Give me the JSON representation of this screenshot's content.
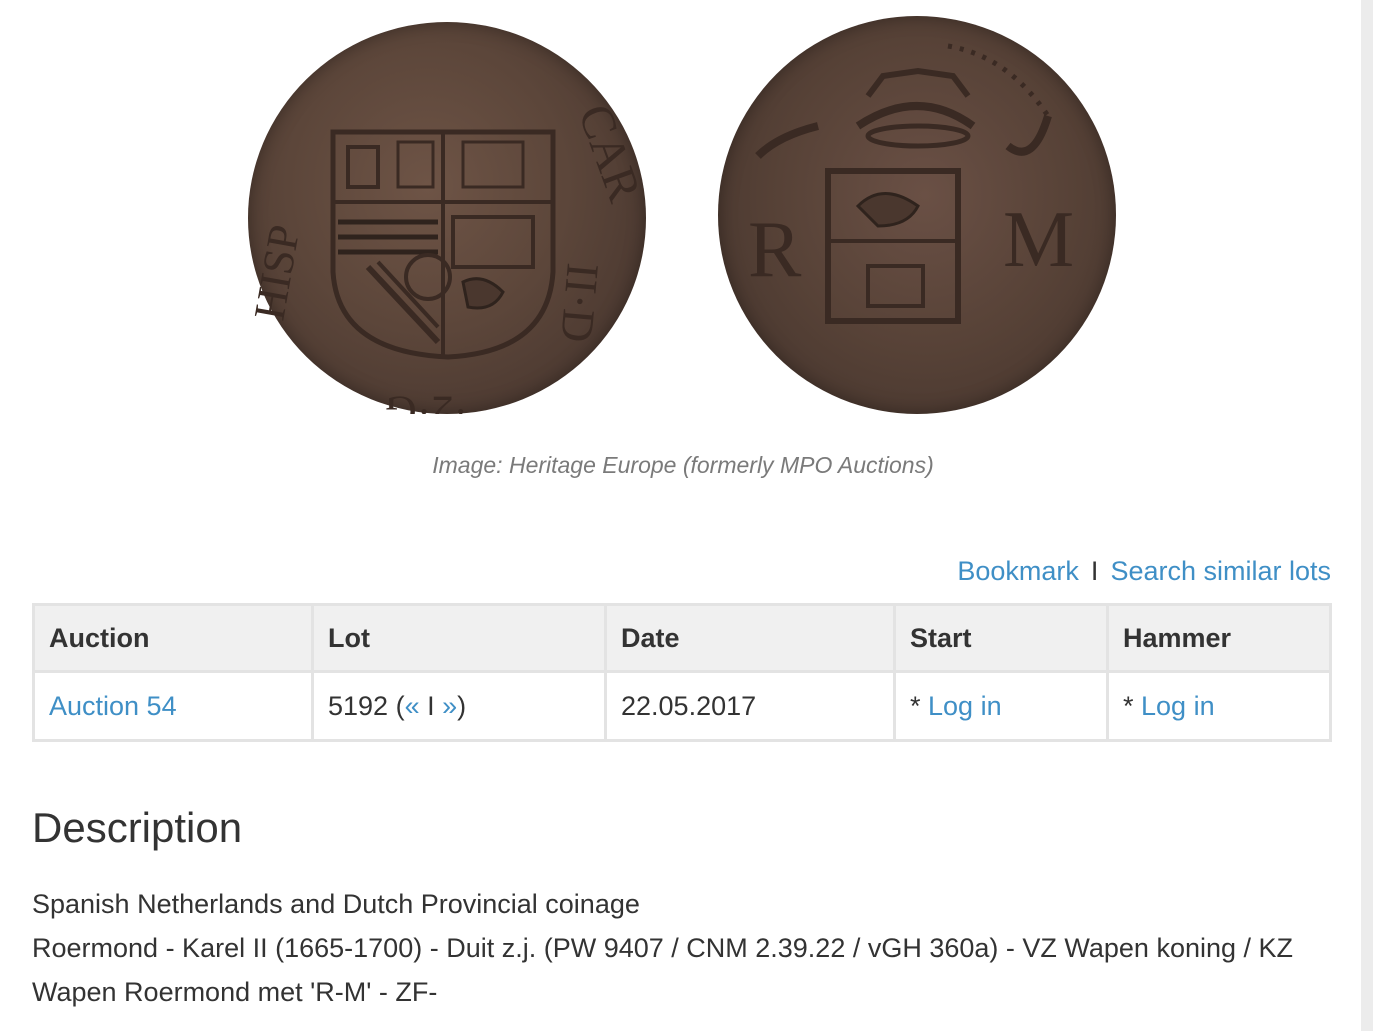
{
  "image": {
    "caption": "Image: Heritage Europe (formerly MPO Auctions)",
    "obverse_name": "coin-obverse-image",
    "reverse_name": "coin-reverse-image"
  },
  "actions": {
    "bookmark": "Bookmark",
    "separator": "I",
    "search_similar": "Search similar lots"
  },
  "table": {
    "headers": [
      "Auction",
      "Lot",
      "Date",
      "Start",
      "Hammer"
    ],
    "row": {
      "auction": "Auction 54",
      "lot_number": "5192 (",
      "lot_prev": "«",
      "lot_sep": " I ",
      "lot_next": "»",
      "lot_close": ")",
      "date": "22.05.2017",
      "start_prefix": "* ",
      "start_link": "Log in",
      "hammer_prefix": "* ",
      "hammer_link": "Log in"
    }
  },
  "description": {
    "title": "Description",
    "line1": "Spanish Netherlands and Dutch Provincial coinage",
    "line2": "Roermond - Karel II (1665-1700) - Duit z.j. (PW 9407 / CNM 2.39.22 / vGH 360a) - VZ Wapen koning / KZ Wapen Roermond met 'R-M' - ZF-"
  },
  "colors": {
    "link": "#3f8fc6",
    "header_bg": "#f0f0f0",
    "border": "#e3e3e3",
    "caption": "#7a7a7a"
  }
}
